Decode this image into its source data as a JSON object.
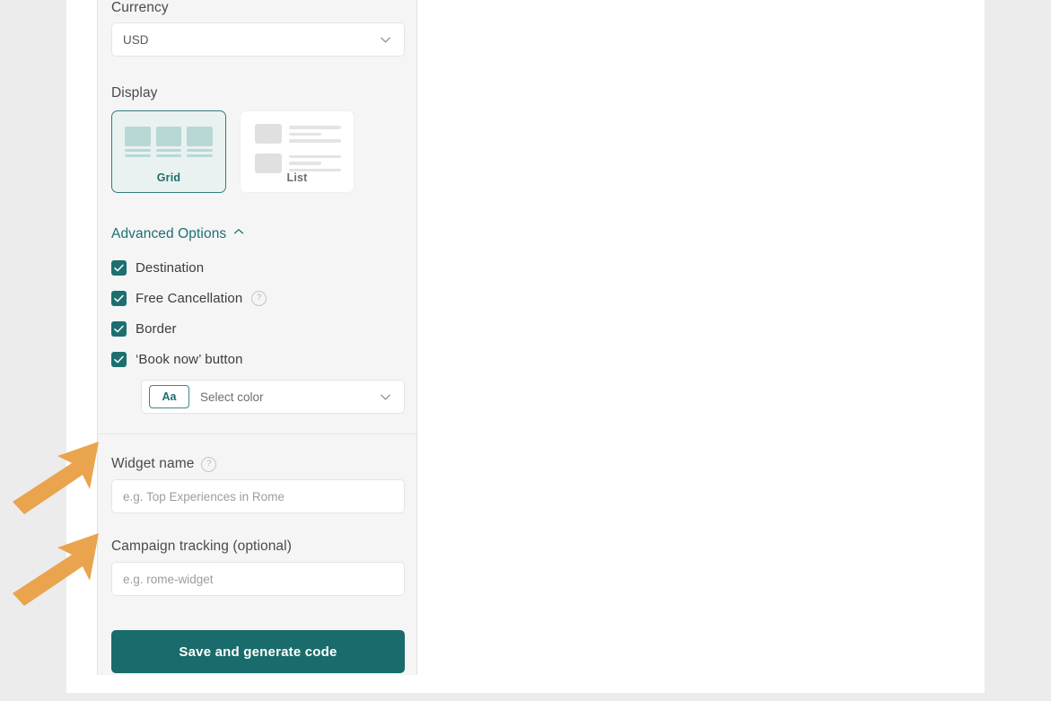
{
  "panel": {
    "currency": {
      "label": "Currency",
      "value": "USD",
      "chevron_icon": "chevron-down-icon"
    },
    "display": {
      "label": "Display",
      "options": [
        {
          "label": "Grid",
          "selected": true
        },
        {
          "label": "List",
          "selected": false
        }
      ]
    },
    "advanced": {
      "header": "Advanced Options",
      "chevron_icon": "chevron-up-icon",
      "checkboxes": [
        {
          "label": "Destination",
          "checked": true,
          "help": false
        },
        {
          "label": "Free Cancellation",
          "checked": true,
          "help": true
        },
        {
          "label": "Border",
          "checked": true,
          "help": false
        },
        {
          "label": "‘Book now’ button",
          "checked": true,
          "help": false
        }
      ],
      "color_select": {
        "swatch_label": "Aa",
        "placeholder": "Select color",
        "chevron_icon": "chevron-down-icon"
      }
    },
    "widget_name": {
      "label": "Widget name",
      "help": true,
      "placeholder": "e.g. Top Experiences in Rome",
      "value": ""
    },
    "campaign_tracking": {
      "label": "Campaign tracking (optional)",
      "placeholder": "e.g. rome-widget",
      "value": ""
    },
    "save_button": "Save and generate code"
  },
  "annotations": {
    "arrow_color": "#eaa44e",
    "arrows": [
      {
        "name": "arrow-to-widget-name"
      },
      {
        "name": "arrow-to-campaign-tracking"
      }
    ]
  },
  "colors": {
    "teal": "#1a6b6b",
    "teal_light": "#e9f2f1",
    "page_bg": "#ececec",
    "panel_bg": "#f5f5f5",
    "orange": "#eaa44e"
  }
}
